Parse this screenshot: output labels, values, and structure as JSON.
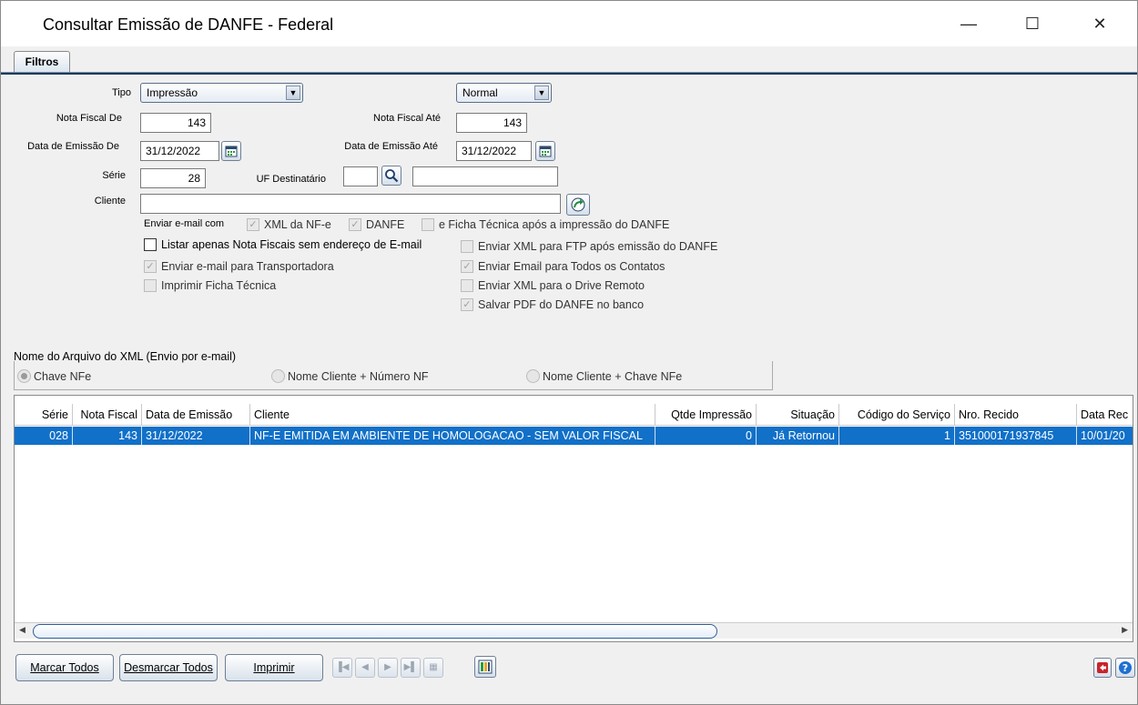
{
  "window": {
    "title": "Consultar Emissão de DANFE - Federal",
    "minimize_glyph": "—",
    "maximize_glyph": "☐",
    "close_glyph": "✕"
  },
  "tabs": [
    {
      "label": "Filtros",
      "active": true
    }
  ],
  "filters": {
    "tipo_label": "Tipo",
    "tipo_value": "Impressão",
    "modo_value": "Normal",
    "nota_de_label": "Nota Fiscal De",
    "nota_de_value": "143",
    "nota_ate_label": "Nota Fiscal Até",
    "nota_ate_value": "143",
    "data_de_label": "Data de Emissão De",
    "data_de_value": "31/12/2022",
    "data_ate_label": "Data de Emissão Até",
    "data_ate_value": "31/12/2022",
    "serie_label": "Série",
    "serie_value": "28",
    "uf_label": "UF Destinatário",
    "uf_value": "",
    "uf_desc_value": "",
    "cliente_label": "Cliente",
    "cliente_value": ""
  },
  "email_options": {
    "label": "Enviar e-mail com",
    "xml_nfe": {
      "label": "XML da NF-e",
      "checked": true,
      "enabled": false
    },
    "danfe": {
      "label": "DANFE",
      "checked": true,
      "enabled": false
    },
    "ficha_tecnica": {
      "label": "e Ficha Técnica após a impressão do DANFE",
      "checked": false,
      "enabled": false
    }
  },
  "options_left": [
    {
      "label": "Listar apenas Nota Fiscais sem endereço de E-mail",
      "checked": false,
      "enabled": true
    },
    {
      "label": "Enviar e-mail para Transportadora",
      "checked": true,
      "enabled": false
    },
    {
      "label": "Imprimir Ficha Técnica",
      "checked": false,
      "enabled": false
    }
  ],
  "options_right": [
    {
      "label": "Enviar XML para FTP após emissão do DANFE",
      "checked": false,
      "enabled": false
    },
    {
      "label": "Enviar Email para Todos os Contatos",
      "checked": true,
      "enabled": false
    },
    {
      "label": "Enviar XML para o Drive Remoto",
      "checked": false,
      "enabled": false
    },
    {
      "label": "Salvar PDF do DANFE no banco",
      "checked": true,
      "enabled": false
    }
  ],
  "xml_name_group": {
    "title": "Nome do Arquivo do XML (Envio por e-mail)",
    "options": [
      {
        "label": "Chave NFe",
        "selected": true
      },
      {
        "label": "Nome Cliente + Número NF",
        "selected": false
      },
      {
        "label": "Nome Cliente + Chave NFe",
        "selected": false
      }
    ]
  },
  "grid": {
    "columns": [
      "Série",
      "Nota Fiscal",
      "Data de Emissão",
      "Cliente",
      "Qtde Impressão",
      "Situação",
      "Código do Serviço",
      "Nro. Recido",
      "Data Rec"
    ],
    "rows": [
      [
        "028",
        "143",
        "31/12/2022",
        "NF-E EMITIDA EM AMBIENTE DE HOMOLOGACAO - SEM VALOR FISCAL",
        "0",
        "Já Retornou",
        "1",
        "351000171937845",
        "10/01/20"
      ]
    ]
  },
  "footer": {
    "marcar_todos": "Marcar Todos",
    "desmarcar_todos": "Desmarcar Todos",
    "imprimir": "Imprimir"
  },
  "colors": {
    "selection": "#1170c8",
    "tab_underline": "#1f3a5a"
  }
}
